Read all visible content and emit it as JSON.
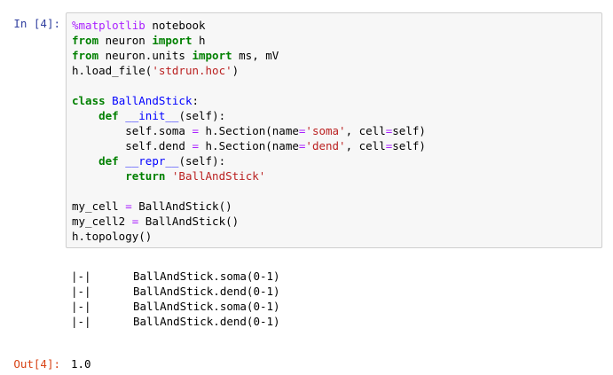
{
  "cell": {
    "in_prompt": "In [4]:",
    "out_prompt": "Out[4]:",
    "code_lines": [
      [
        {
          "t": "%matplotlib",
          "c": "magic"
        },
        {
          "t": " notebook",
          "c": ""
        }
      ],
      [
        {
          "t": "from",
          "c": "kw"
        },
        {
          "t": " neuron ",
          "c": ""
        },
        {
          "t": "import",
          "c": "kw"
        },
        {
          "t": " h",
          "c": ""
        }
      ],
      [
        {
          "t": "from",
          "c": "kw"
        },
        {
          "t": " neuron.units ",
          "c": ""
        },
        {
          "t": "import",
          "c": "kw"
        },
        {
          "t": " ms, mV",
          "c": ""
        }
      ],
      [
        {
          "t": "h.load_file(",
          "c": ""
        },
        {
          "t": "'stdrun.hoc'",
          "c": "str"
        },
        {
          "t": ")",
          "c": ""
        }
      ],
      [],
      [
        {
          "t": "class",
          "c": "kw"
        },
        {
          "t": " ",
          "c": ""
        },
        {
          "t": "BallAndStick",
          "c": "cls"
        },
        {
          "t": ":",
          "c": ""
        }
      ],
      [
        {
          "t": "    ",
          "c": ""
        },
        {
          "t": "def",
          "c": "kw"
        },
        {
          "t": " ",
          "c": ""
        },
        {
          "t": "__init__",
          "c": "fn"
        },
        {
          "t": "(self):",
          "c": ""
        }
      ],
      [
        {
          "t": "        self.soma ",
          "c": ""
        },
        {
          "t": "=",
          "c": "op"
        },
        {
          "t": " h.Section(name",
          "c": ""
        },
        {
          "t": "=",
          "c": "op"
        },
        {
          "t": "'soma'",
          "c": "str"
        },
        {
          "t": ", cell",
          "c": ""
        },
        {
          "t": "=",
          "c": "op"
        },
        {
          "t": "self)",
          "c": ""
        }
      ],
      [
        {
          "t": "        self.dend ",
          "c": ""
        },
        {
          "t": "=",
          "c": "op"
        },
        {
          "t": " h.Section(name",
          "c": ""
        },
        {
          "t": "=",
          "c": "op"
        },
        {
          "t": "'dend'",
          "c": "str"
        },
        {
          "t": ", cell",
          "c": ""
        },
        {
          "t": "=",
          "c": "op"
        },
        {
          "t": "self)",
          "c": ""
        }
      ],
      [
        {
          "t": "    ",
          "c": ""
        },
        {
          "t": "def",
          "c": "kw"
        },
        {
          "t": " ",
          "c": ""
        },
        {
          "t": "__repr__",
          "c": "fn"
        },
        {
          "t": "(self):",
          "c": ""
        }
      ],
      [
        {
          "t": "        ",
          "c": ""
        },
        {
          "t": "return",
          "c": "kw"
        },
        {
          "t": " ",
          "c": ""
        },
        {
          "t": "'BallAndStick'",
          "c": "str"
        }
      ],
      [],
      [
        {
          "t": "my_cell ",
          "c": ""
        },
        {
          "t": "=",
          "c": "op"
        },
        {
          "t": " BallAndStick()",
          "c": ""
        }
      ],
      [
        {
          "t": "my_cell2 ",
          "c": ""
        },
        {
          "t": "=",
          "c": "op"
        },
        {
          "t": " BallAndStick()",
          "c": ""
        }
      ],
      [
        {
          "t": "h.topology()",
          "c": ""
        }
      ]
    ],
    "stream_output": [
      {
        "bar": "|-|",
        "text": "BallAndStick.soma(0-1)"
      },
      {
        "bar": "|-|",
        "text": "BallAndStick.dend(0-1)"
      },
      {
        "bar": "|-|",
        "text": "BallAndStick.soma(0-1)"
      },
      {
        "bar": "|-|",
        "text": "BallAndStick.dend(0-1)"
      }
    ],
    "result": "1.0"
  }
}
